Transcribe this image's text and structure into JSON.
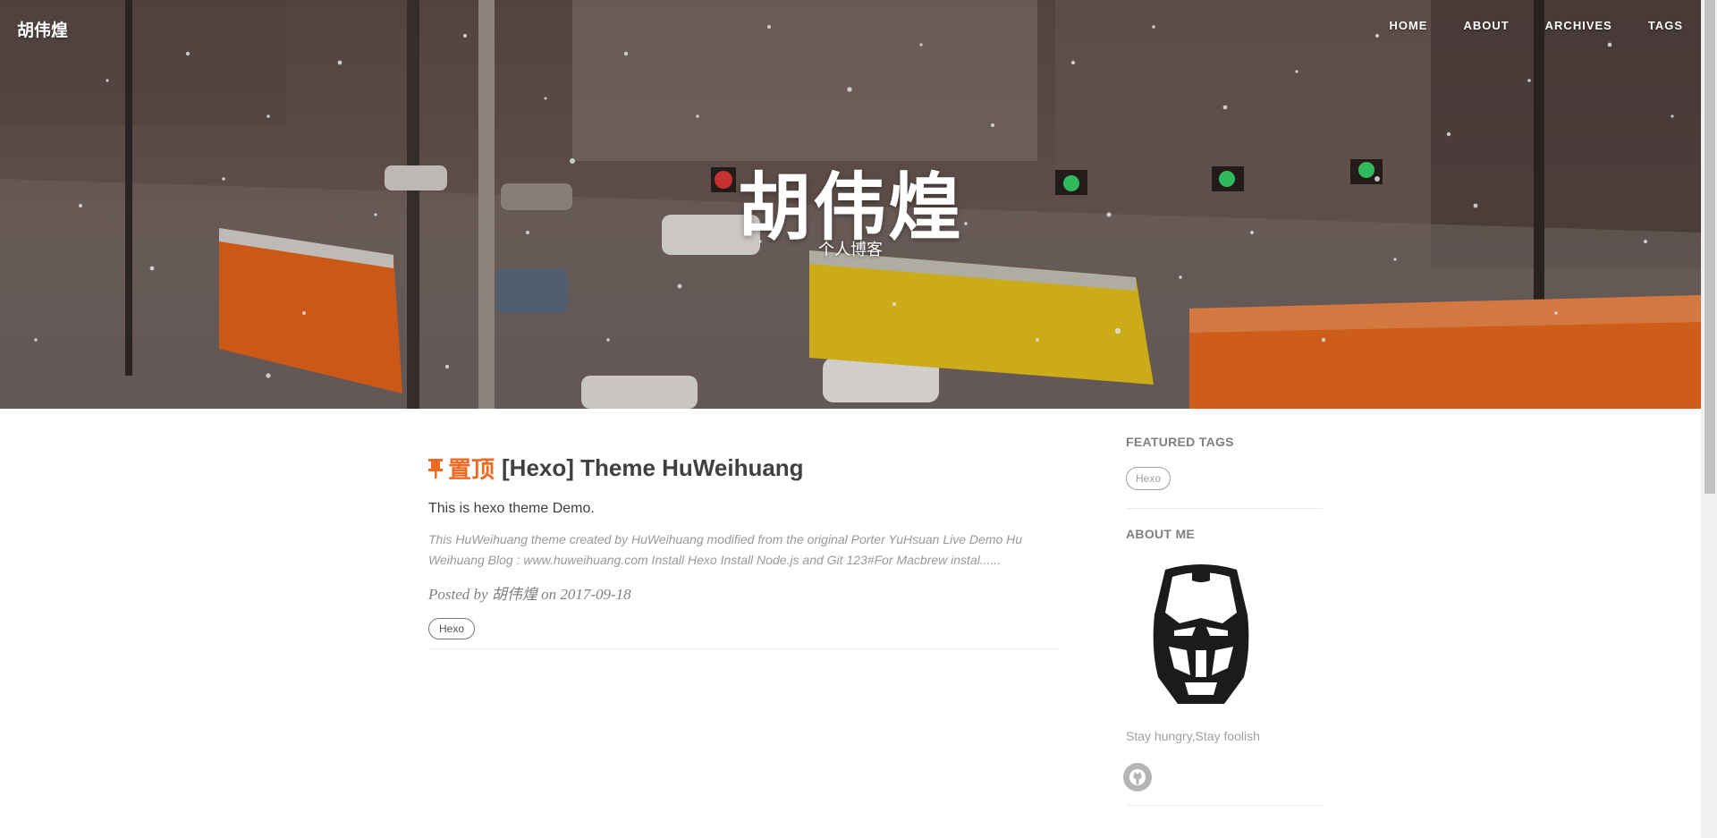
{
  "header": {
    "brand": "胡伟煌",
    "nav": [
      "HOME",
      "ABOUT",
      "ARCHIVES",
      "TAGS"
    ],
    "title": "胡伟煌",
    "subtitle": "个人博客"
  },
  "post": {
    "pin_label": "置顶",
    "title": "[Hexo] Theme HuWeihuang",
    "subtitle": "This is hexo theme Demo.",
    "excerpt": "This HuWeihuang theme created by HuWeihuang modified from the original Porter YuHsuan Live Demo Hu Weihuang Blog : www.huweihuang.com Install Hexo Install Node.js and Git 123#For Macbrew instal......",
    "meta_prefix": "Posted by",
    "author": "胡伟煌",
    "meta_on": "on",
    "date": "2017-09-18",
    "tag": "Hexo"
  },
  "sidebar": {
    "featured_tags_heading": "FEATURED TAGS",
    "tags": [
      "Hexo"
    ],
    "about_heading": "ABOUT ME",
    "motto": "Stay hungry,Stay foolish"
  },
  "icons": {
    "pin": "pushpin-icon",
    "avatar": "iron-man-mask-icon",
    "github": "github-icon"
  },
  "colors": {
    "accent": "#f06a21"
  }
}
